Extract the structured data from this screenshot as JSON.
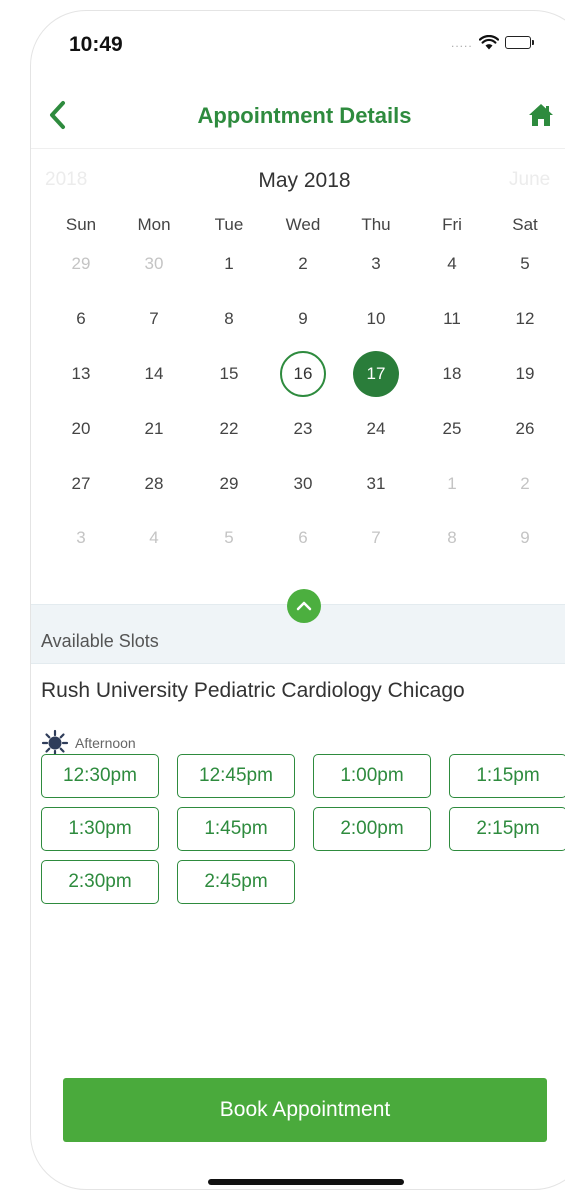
{
  "status_bar": {
    "time": "10:49",
    "signal": "....."
  },
  "nav": {
    "title": "Appointment Details"
  },
  "calendar": {
    "prev_month": "2018",
    "current_month": "May 2018",
    "next_month": "June",
    "weekdays": [
      "Sun",
      "Mon",
      "Tue",
      "Wed",
      "Thu",
      "Fri",
      "Sat"
    ],
    "weeks": [
      [
        "29",
        "30",
        "1",
        "2",
        "3",
        "4",
        "5"
      ],
      [
        "6",
        "7",
        "8",
        "9",
        "10",
        "11",
        "12"
      ],
      [
        "13",
        "14",
        "15",
        "16",
        "17",
        "18",
        "19"
      ],
      [
        "20",
        "21",
        "22",
        "23",
        "24",
        "25",
        "26"
      ],
      [
        "27",
        "28",
        "29",
        "30",
        "31",
        "1",
        "2"
      ],
      [
        "3",
        "4",
        "5",
        "6",
        "7",
        "8",
        "9"
      ]
    ],
    "today": "16",
    "selected": "17"
  },
  "slots": {
    "header": "Available Slots",
    "provider": "Rush University Pediatric Cardiology Chicago",
    "period_label": "Afternoon",
    "times": [
      "12:30pm",
      "12:45pm",
      "1:00pm",
      "1:15pm",
      "1:30pm",
      "1:45pm",
      "2:00pm",
      "2:15pm",
      "2:30pm",
      "2:45pm"
    ]
  },
  "actions": {
    "book_label": "Book Appointment"
  },
  "colors": {
    "accent": "#2e8b3e",
    "button": "#4aaa3c",
    "selected_day": "#2a7d3a"
  }
}
